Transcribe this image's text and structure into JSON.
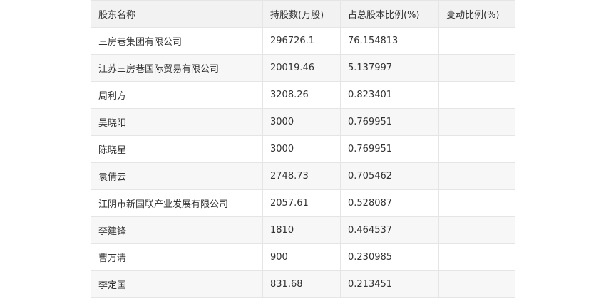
{
  "table": {
    "headers": [
      "股东名称",
      "持股数(万股)",
      "占总股本比例(%)",
      "变动比例(%)"
    ],
    "rows": [
      [
        "三房巷集团有限公司",
        "296726.1",
        "76.154813",
        ""
      ],
      [
        "江苏三房巷国际贸易有限公司",
        "20019.46",
        "5.137997",
        ""
      ],
      [
        "周利方",
        "3208.26",
        "0.823401",
        ""
      ],
      [
        "吴晓阳",
        "3000",
        "0.769951",
        ""
      ],
      [
        "陈晓星",
        "3000",
        "0.769951",
        ""
      ],
      [
        "袁倩云",
        "2748.73",
        "0.705462",
        ""
      ],
      [
        "江阴市新国联产业发展有限公司",
        "2057.61",
        "0.528087",
        ""
      ],
      [
        "李建锋",
        "1810",
        "0.464537",
        ""
      ],
      [
        "曹万清",
        "900",
        "0.230985",
        ""
      ],
      [
        "李定国",
        "831.68",
        "0.213451",
        ""
      ]
    ]
  }
}
